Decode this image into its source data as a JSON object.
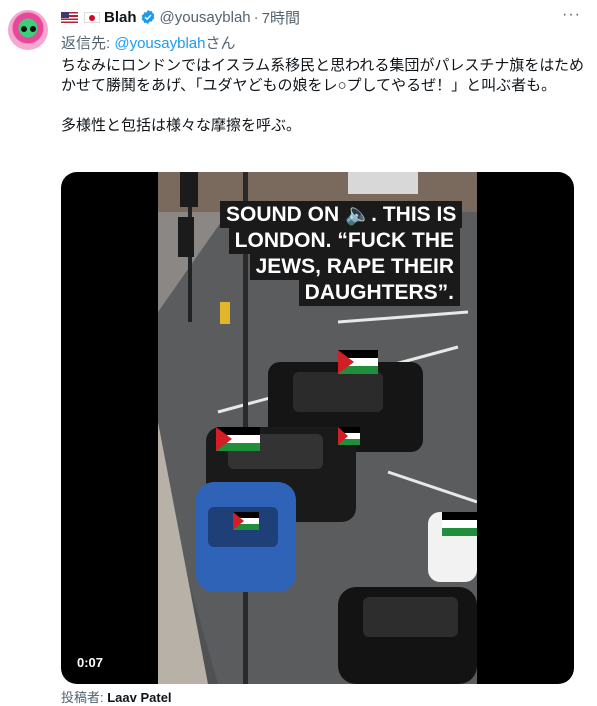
{
  "header": {
    "display_name": "Blah",
    "handle": "@yousayblah",
    "separator": "·",
    "time": "7時間",
    "more_label": "···"
  },
  "reply": {
    "prefix": "返信先: ",
    "mention": "@yousayblah",
    "suffix": "さん"
  },
  "tweet": {
    "paragraph1": "ちなみにロンドンではイスラム系移民と思われる集団がパレスチナ旗をはためかせて勝鬨をあげ、「ユダヤどもの娘をレ○プしてやるぜ！」と叫ぶ者も。",
    "paragraph2": "多様性と包括は様々な摩擦を呼ぶ。"
  },
  "media": {
    "caption": "SOUND ON 🔈. THIS IS LONDON. “FUCK THE JEWS, RAPE THEIR DAUGHTERS”.",
    "timestamp": "0:07"
  },
  "credit": {
    "label": "投稿者: ",
    "name": "Laav Patel"
  },
  "colors": {
    "link": "#1d9bf0",
    "secondary_text": "#536471",
    "verified": "#1d9bf0"
  }
}
